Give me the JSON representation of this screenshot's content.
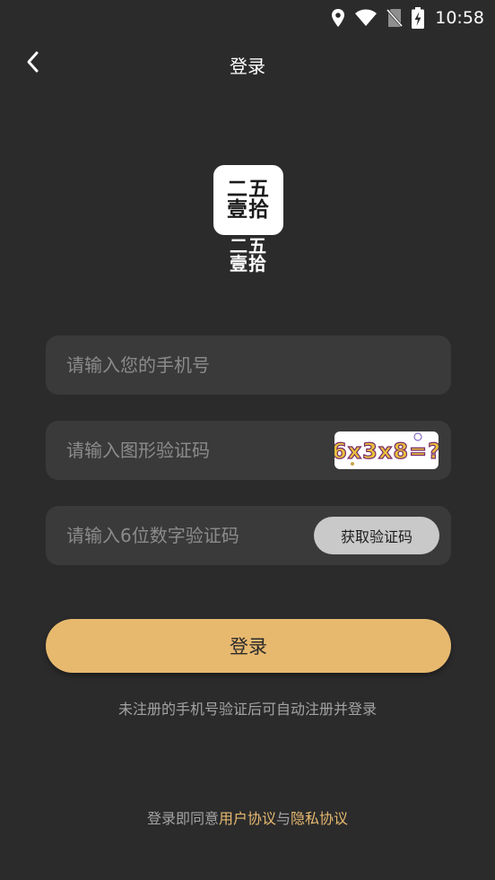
{
  "status_bar": {
    "time": "10:58",
    "icons": [
      "location-icon",
      "wifi-icon",
      "no-sim-icon",
      "battery-charging-icon"
    ]
  },
  "header": {
    "back_icon": "chevron-left-icon",
    "title": "登录"
  },
  "logo": {
    "line1": "二五",
    "line2": "壹拾",
    "text_line1": "二五",
    "text_line2": "壹拾"
  },
  "form": {
    "phone": {
      "placeholder": "请输入您的手机号",
      "value": ""
    },
    "captcha": {
      "placeholder": "请输入图形验证码",
      "value": "",
      "image_text": "6x3x8=?"
    },
    "sms_code": {
      "placeholder": "请输入6位数字验证码",
      "value": "",
      "button_label": "获取验证码"
    }
  },
  "login_button": "登录",
  "hint": "未注册的手机号验证后可自动注册并登录",
  "agreement": {
    "prefix": "登录即同意",
    "user_agreement": "用户协议",
    "and": "与",
    "privacy_agreement": "隐私协议"
  },
  "colors": {
    "background": "#2b2b2c",
    "field": "#3a3a3b",
    "accent": "#e7b96f",
    "code_button": "#c9c9c9"
  }
}
